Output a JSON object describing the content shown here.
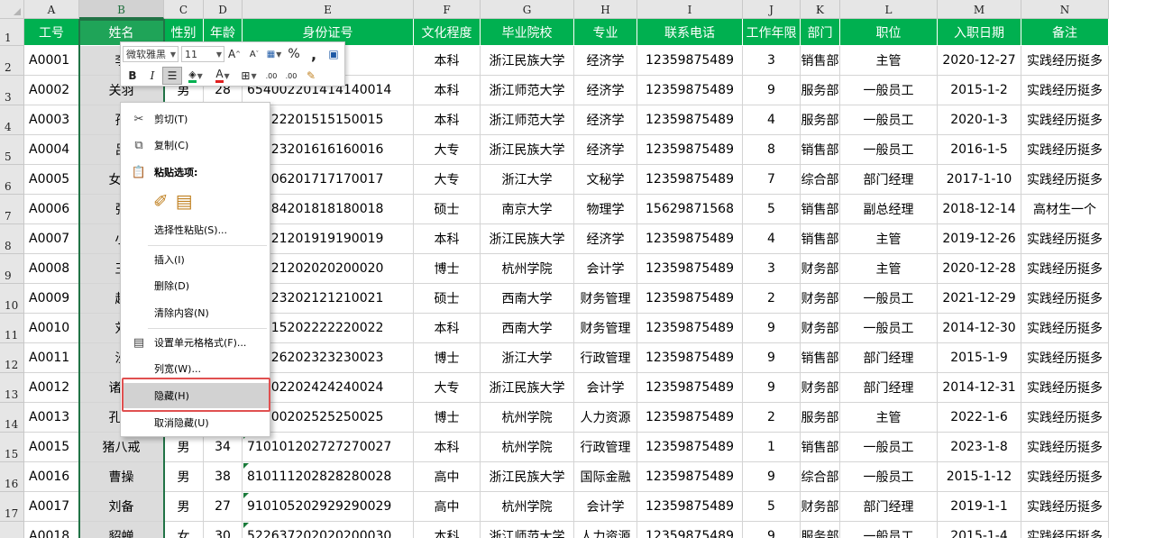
{
  "columns": [
    "A",
    "B",
    "C",
    "D",
    "E",
    "F",
    "G",
    "H",
    "I",
    "J",
    "K",
    "L",
    "M",
    "N"
  ],
  "headers": [
    "工号",
    "姓名",
    "性别",
    "年龄",
    "身份证号",
    "文化程度",
    "毕业院校",
    "专业",
    "联系电话",
    "工作年限",
    "部门",
    "职位",
    "入职日期",
    "备注"
  ],
  "rows": [
    {
      "num": "2",
      "cells": [
        "A0001",
        "李",
        "",
        "",
        "30013",
        "本科",
        "浙江民族大学",
        "经济学",
        "12359875489",
        "3",
        "销售部",
        "主管",
        "2020-12-27",
        "实践经历挺多"
      ]
    },
    {
      "num": "3",
      "cells": [
        "A0002",
        "关羽",
        "男",
        "28",
        "654002201414140014",
        "本科",
        "浙江师范大学",
        "经济学",
        "12359875489",
        "9",
        "服务部",
        "一般员工",
        "2015-1-2",
        "实践经历挺多"
      ]
    },
    {
      "num": "4",
      "cells": [
        "A0003",
        "孙",
        "",
        "",
        "71322201515150015",
        "本科",
        "浙江师范大学",
        "经济学",
        "12359875489",
        "4",
        "服务部",
        "一般员工",
        "2020-1-3",
        "实践经历挺多"
      ]
    },
    {
      "num": "5",
      "cells": [
        "A0004",
        "吕",
        "",
        "",
        "42123201616160016",
        "大专",
        "浙江民族大学",
        "经济学",
        "12359875489",
        "8",
        "销售部",
        "一般员工",
        "2016-1-5",
        "实践经历挺多"
      ]
    },
    {
      "num": "6",
      "cells": [
        "A0005",
        "女儿",
        "",
        "",
        "10106201717170017",
        "大专",
        "浙江大学",
        "文秘学",
        "12359875489",
        "7",
        "综合部",
        "部门经理",
        "2017-1-10",
        "实践经历挺多"
      ]
    },
    {
      "num": "7",
      "cells": [
        "A0006",
        "张",
        "",
        "",
        "20984201818180018",
        "硕士",
        "南京大学",
        "物理学",
        "15629871568",
        "5",
        "销售部",
        "副总经理",
        "2018-12-14",
        "高材生一个"
      ]
    },
    {
      "num": "8",
      "cells": [
        "A0007",
        "小",
        "",
        "",
        "20521201919190019",
        "本科",
        "浙江民族大学",
        "经济学",
        "12359875489",
        "4",
        "销售部",
        "主管",
        "2019-12-26",
        "实践经历挺多"
      ]
    },
    {
      "num": "9",
      "cells": [
        "A0008",
        "王",
        "",
        "",
        "40421202020200020",
        "博士",
        "杭州学院",
        "会计学",
        "12359875489",
        "3",
        "财务部",
        "主管",
        "2020-12-28",
        "实践经历挺多"
      ]
    },
    {
      "num": "10",
      "cells": [
        "A0009",
        "赵",
        "",
        "",
        "30623202121210021",
        "硕士",
        "西南大学",
        "财务管理",
        "12359875489",
        "2",
        "财务部",
        "一般员工",
        "2021-12-29",
        "实践经历挺多"
      ]
    },
    {
      "num": "11",
      "cells": [
        "A0010",
        "刘",
        "",
        "",
        "10115202222220022",
        "本科",
        "西南大学",
        "财务管理",
        "12359875489",
        "9",
        "财务部",
        "一般员工",
        "2014-12-30",
        "实践经历挺多"
      ]
    },
    {
      "num": "12",
      "cells": [
        "A0011",
        "沙",
        "",
        "",
        "30726202323230023",
        "博士",
        "浙江大学",
        "行政管理",
        "12359875489",
        "9",
        "销售部",
        "部门经理",
        "2015-1-9",
        "实践经历挺多"
      ]
    },
    {
      "num": "13",
      "cells": [
        "A0012",
        "诸葛",
        "",
        "",
        "40302202424240024",
        "大专",
        "浙江民族大学",
        "会计学",
        "12359875489",
        "9",
        "财务部",
        "部门经理",
        "2014-12-31",
        "实践经历挺多"
      ]
    },
    {
      "num": "14",
      "cells": [
        "A0013",
        "孔子",
        "",
        "",
        "50000202525250025",
        "博士",
        "杭州学院",
        "人力资源",
        "12359875489",
        "2",
        "服务部",
        "主管",
        "2022-1-6",
        "实践经历挺多"
      ]
    },
    {
      "num": "15",
      "cells": [
        "A0015",
        "猪八戒",
        "男",
        "34",
        "710101202727270027",
        "本科",
        "杭州学院",
        "行政管理",
        "12359875489",
        "1",
        "销售部",
        "一般员工",
        "2023-1-8",
        "实践经历挺多"
      ]
    },
    {
      "num": "16",
      "cells": [
        "A0016",
        "曹操",
        "男",
        "38",
        "810111202828280028",
        "高中",
        "浙江民族大学",
        "国际金融",
        "12359875489",
        "9",
        "综合部",
        "一般员工",
        "2015-1-12",
        "实践经历挺多"
      ]
    },
    {
      "num": "17",
      "cells": [
        "A0017",
        "刘备",
        "男",
        "27",
        "910105202929290029",
        "高中",
        "杭州学院",
        "会计学",
        "12359875489",
        "5",
        "财务部",
        "部门经理",
        "2019-1-1",
        "实践经历挺多"
      ]
    },
    {
      "num": "18",
      "cells": [
        "A0018",
        "貂蝉",
        "女",
        "30",
        "522637202020200030",
        "本科",
        "浙江师范大学",
        "人力资源",
        "12359875489",
        "9",
        "服务部",
        "一般员工",
        "2015-1-4",
        "实践经历挺多"
      ]
    }
  ],
  "header_row_num": "1",
  "colors": {
    "header_bg": "#00b050",
    "header_text": "#ffffff",
    "selection": "#217346",
    "highlight_outline": "#e05050"
  },
  "mini_toolbar": {
    "font_name": "微软雅黑",
    "font_size": "11",
    "grow_font": "A",
    "shrink_font": "A",
    "bold": "B",
    "italic": "I",
    "percent": "%",
    "comma": ",",
    "fill_icon_label": "A",
    "font_color_label": "A",
    "inc_decimal": ".00",
    "dec_decimal": ".00"
  },
  "context_menu": {
    "cut": "剪切(T)",
    "copy": "复制(C)",
    "paste_options": "粘贴选项:",
    "paste_special": "选择性粘贴(S)...",
    "insert": "插入(I)",
    "delete": "删除(D)",
    "clear": "清除内容(N)",
    "format_cells": "设置单元格格式(F)...",
    "column_width": "列宽(W)...",
    "hide": "隐藏(H)",
    "unhide": "取消隐藏(U)"
  }
}
